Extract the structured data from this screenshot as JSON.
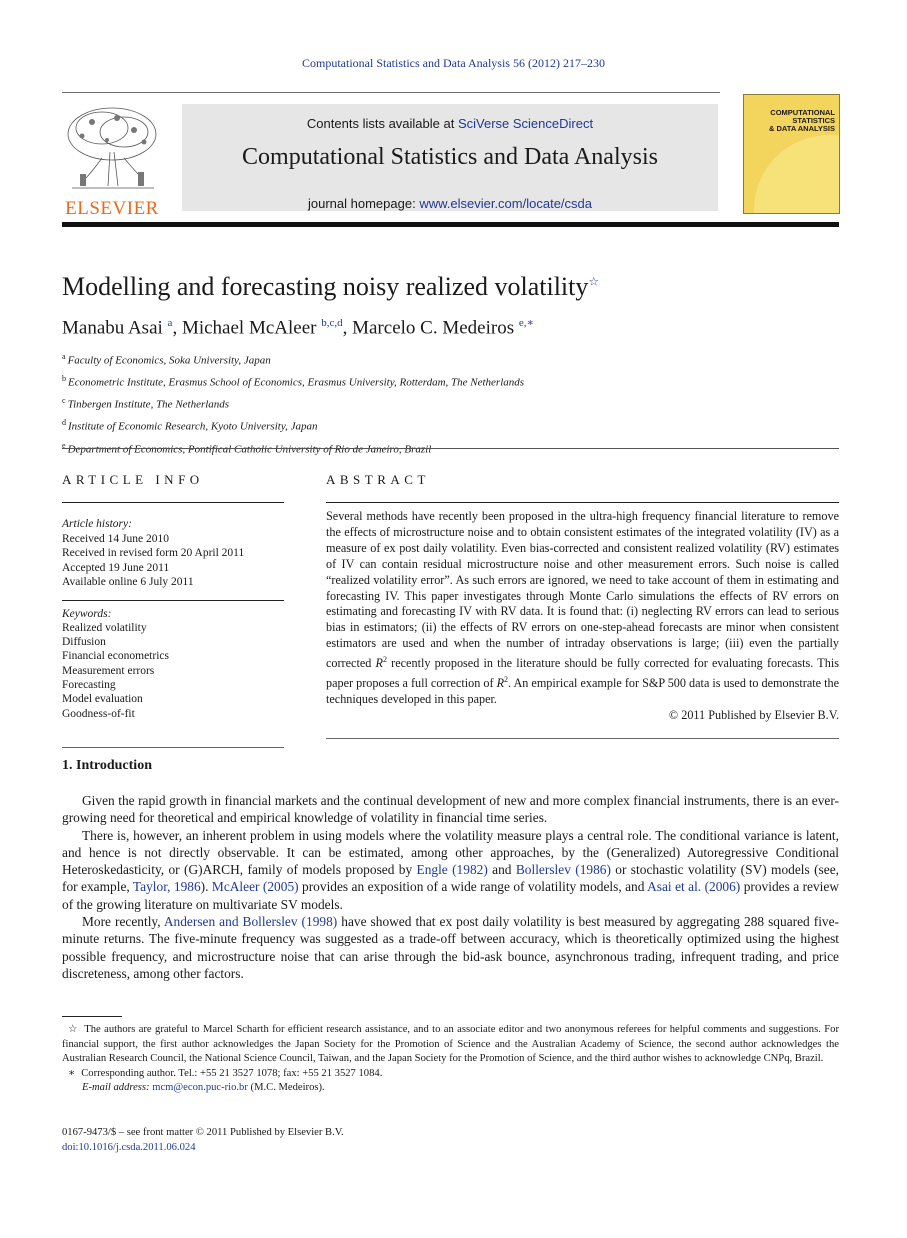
{
  "running_head": "Computational Statistics and Data Analysis 56 (2012) 217–230",
  "masthead": {
    "publisher_logo_text": "ELSEVIER",
    "contents_prefix": "Contents lists available at ",
    "contents_link": "SciVerse ScienceDirect",
    "journal_name": "Computational Statistics and Data Analysis",
    "homepage_prefix": "journal homepage: ",
    "homepage_link": "www.elsevier.com/locate/csda",
    "cover_title": [
      "COMPUTATIONAL",
      "STATISTICS",
      "& DATA ANALYSIS"
    ]
  },
  "article": {
    "title": "Modelling and forecasting noisy realized volatility",
    "title_mark": "☆",
    "authors": [
      {
        "name": "Manabu Asai",
        "sup": "a"
      },
      {
        "name": "Michael McAleer",
        "sup": "b,c,d"
      },
      {
        "name": "Marcelo C. Medeiros",
        "sup": "e,∗"
      }
    ],
    "affiliations": [
      {
        "key": "a",
        "text": "Faculty of Economics, Soka University, Japan"
      },
      {
        "key": "b",
        "text": "Econometric Institute, Erasmus School of Economics, Erasmus University, Rotterdam, The Netherlands"
      },
      {
        "key": "c",
        "text": "Tinbergen Institute, The Netherlands"
      },
      {
        "key": "d",
        "text": "Institute of Economic Research, Kyoto University, Japan"
      },
      {
        "key": "e",
        "text": "Department of Economics, Pontifical Catholic University of Rio de Janeiro, Brazil"
      }
    ]
  },
  "article_info": {
    "heading": "ARTICLE INFO",
    "history_label": "Article history:",
    "history": [
      "Received 14 June 2010",
      "Received in revised form 20 April 2011",
      "Accepted 19 June 2011",
      "Available online 6 July 2011"
    ],
    "keywords_label": "Keywords:",
    "keywords": [
      "Realized volatility",
      "Diffusion",
      "Financial econometrics",
      "Measurement errors",
      "Forecasting",
      "Model evaluation",
      "Goodness-of-fit"
    ]
  },
  "abstract": {
    "heading": "ABSTRACT",
    "text_1": "Several methods have recently been proposed in the ultra-high frequency financial literature to remove the effects of microstructure noise and to obtain consistent estimates of the integrated volatility (IV) as a measure of ex post daily volatility. Even bias-corrected and consistent realized volatility (RV) estimates of IV can contain residual microstructure noise and other measurement errors. Such noise is called “realized volatility error”. As such errors are ignored, we need to take account of them in estimating and forecasting IV. This paper investigates through Monte Carlo simulations the effects of RV errors on estimating and forecasting IV with RV data. It is found that: (i) neglecting RV errors can lead to serious bias in estimators; (ii) the effects of RV errors on one-step-ahead forecasts are minor when consistent estimators are used and when the number of intraday observations is large; (iii) even the partially corrected ",
    "r2_a": "R",
    "text_2": " recently proposed in the literature should be fully corrected for evaluating forecasts. This paper proposes a full correction of ",
    "r2_b": "R",
    "text_3": ". An empirical example for S&P 500 data is used to demonstrate the techniques developed in this paper.",
    "superscript": "2",
    "copyright": "© 2011 Published by Elsevier B.V."
  },
  "introduction": {
    "heading": "1.  Introduction",
    "p1": "Given the rapid growth in financial markets and the continual development of new and more complex financial instruments, there is an ever-growing need for theoretical and empirical knowledge of volatility in financial time series.",
    "p2_a": "There is, however, an inherent problem in using models where the volatility measure plays a central role. The conditional variance is latent, and hence is not directly observable. It can be estimated, among other approaches, by the (Generalized) Autoregressive Conditional Heteroskedasticity, or (G)ARCH, family of models proposed by ",
    "ref_engle": "Engle (1982)",
    "p2_b": " and ",
    "ref_bollerslev": "Bollerslev (1986)",
    "p2_c": " or stochastic volatility (SV) models (see, for example, ",
    "ref_taylor": "Taylor, 1986",
    "p2_d": "). ",
    "ref_mcaleer": "McAleer (2005)",
    "p2_e": " provides an exposition of a wide range of volatility models, and ",
    "ref_asai": "Asai et al. (2006)",
    "p2_f": " provides a review of the growing literature on multivariate SV models.",
    "p3_a": "More recently, ",
    "ref_andersen": "Andersen and Bollerslev (1998)",
    "p3_b": " have showed that ex post daily volatility is best measured by aggregating 288 squared five-minute returns. The five-minute frequency was suggested as a trade-off between accuracy, which is theoretically optimized using the highest possible frequency, and microstructure noise that can arise through the bid-ask bounce, asynchronous trading, infrequent trading, and price discreteness, among other factors."
  },
  "footnotes": {
    "star_mark": "☆",
    "star_text": "The authors are grateful to Marcel Scharth for efficient research assistance, and to an associate editor and two anonymous referees for helpful comments and suggestions. For financial support, the first author acknowledges the Japan Society for the Promotion of Science and the Australian Academy of Science, the second author acknowledges the Australian Research Council, the National Science Council, Taiwan, and the Japan Society for the Promotion of Science, and the third author wishes to acknowledge CNPq, Brazil.",
    "corr_mark": "∗",
    "corr_text": "Corresponding author. Tel.: +55 21 3527 1078; fax: +55 21 3527 1084.",
    "email_label": "E-mail address: ",
    "email": "mcm@econ.puc-rio.br",
    "email_suffix": " (M.C. Medeiros)."
  },
  "front_matter": {
    "issn_line": "0167-9473/$ – see front matter © 2011 Published by Elsevier B.V.",
    "doi": "doi:10.1016/j.csda.2011.06.024"
  },
  "colors": {
    "link": "#1f3a93",
    "elsevier_orange": "#e86a1a",
    "masthead_gray": "#e6e6e6",
    "cover_yellow": "#f3d45c"
  }
}
